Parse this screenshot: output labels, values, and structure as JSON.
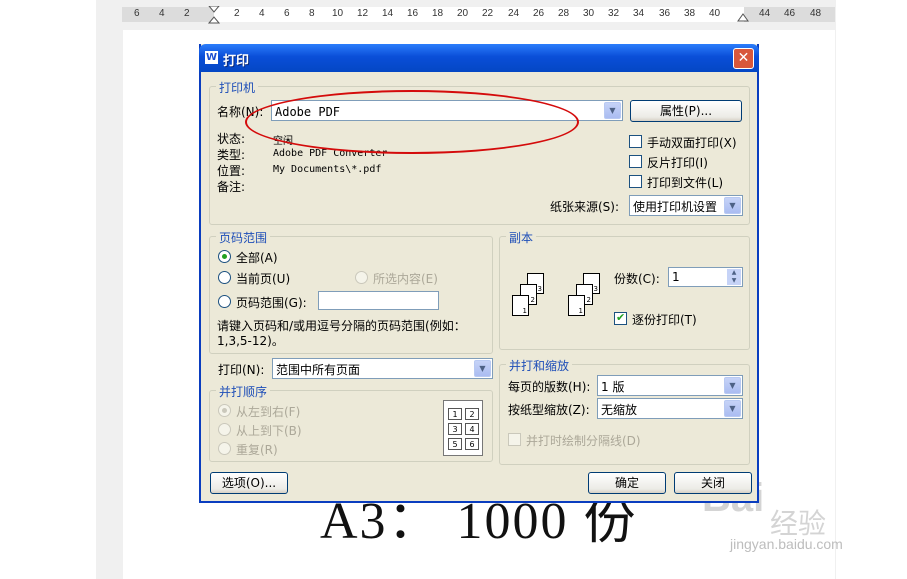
{
  "ruler": {
    "ticks": [
      "6",
      "4",
      "2",
      "2",
      "4",
      "6",
      "8",
      "10",
      "12",
      "14",
      "16",
      "18",
      "20",
      "22",
      "24",
      "26",
      "28",
      "30",
      "32",
      "34",
      "36",
      "38",
      "40",
      "44",
      "46",
      "48"
    ]
  },
  "document": {
    "bigtext": "A3： 1000 份"
  },
  "watermark": {
    "logo": "Bai",
    "brand": "经验",
    "url": "jingyan.baidu.com"
  },
  "dialog": {
    "title": "打印",
    "title_icon": "W",
    "printer": {
      "group_title": "打印机",
      "name_label": "名称(N):",
      "name_value": "Adobe PDF",
      "properties_button": "属性(P)...",
      "status_label": "状态:",
      "status_value": "空闲",
      "type_label": "类型:",
      "type_value": "Adobe PDF Converter",
      "location_label": "位置:",
      "location_value": "My Documents\\*.pdf",
      "comment_label": "备注:",
      "manual_duplex": "手动双面打印(X)",
      "mirror_print": "反片打印(I)",
      "print_to_file": "打印到文件(L)",
      "paper_source_label": "纸张来源(S):",
      "paper_source_value": "使用打印机设置"
    },
    "page_range": {
      "group_title": "页码范围",
      "all": "全部(A)",
      "current_page": "当前页(U)",
      "selection": "所选内容(E)",
      "pages": "页码范围(G):",
      "pages_value": "",
      "hint_line1": "请键入页码和/或用逗号分隔的页码范围(例如：",
      "hint_line2": "1,3,5-12)。"
    },
    "print_what": {
      "label": "打印(N):",
      "value": "范围中所有页面"
    },
    "print_order": {
      "group_title": "并打顺序",
      "left_to_right": "从左到右(F)",
      "top_to_bottom": "从上到下(B)",
      "repeat": "重复(R)",
      "grid": [
        "1",
        "2",
        "3",
        "4",
        "5",
        "6"
      ]
    },
    "copies": {
      "group_title": "副本",
      "count_label": "份数(C):",
      "count_value": "1",
      "collate": "逐份打印(T)",
      "sheet_numbers": [
        "1",
        "2",
        "3"
      ]
    },
    "zoom": {
      "group_title": "并打和缩放",
      "pages_per_sheet_label": "每页的版数(H):",
      "pages_per_sheet_value": "1 版",
      "scale_label": "按纸型缩放(Z):",
      "scale_value": "无缩放",
      "draw_borders": "并打时绘制分隔线(D)"
    },
    "buttons": {
      "options": "选项(O)...",
      "ok": "确定",
      "close": "关闭"
    }
  },
  "colors": {
    "dialog_bg": "#ece9d8",
    "titlebar": "#0a4ed8",
    "group_title": "#1f4fb8",
    "annotation_red": "#d40b0b",
    "check_green": "#21a121"
  }
}
